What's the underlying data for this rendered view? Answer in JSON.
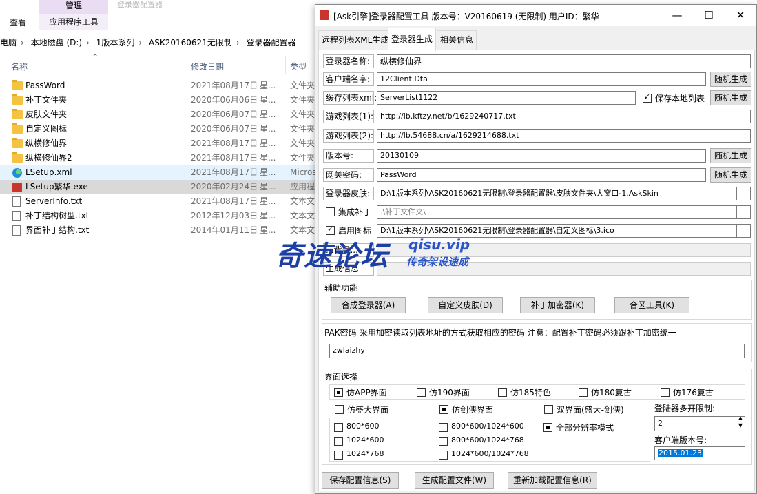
{
  "explorer": {
    "ribbon": {
      "view_tab": "查看",
      "manage_tab": "管理",
      "app_tools_tab": "应用程序工具",
      "faded_title": "登录器配置器"
    },
    "breadcrumb": [
      "电脑",
      "本地磁盘 (D:)",
      "1版本系列",
      "ASK20160621无限制",
      "登录器配置器"
    ],
    "columns": {
      "name": "名称",
      "date": "修改日期",
      "type": "类型"
    },
    "files": [
      {
        "name": "PassWord",
        "date": "2021年08月17日",
        "week": "星...",
        "type": "文件夹",
        "icon": "folder-icon"
      },
      {
        "name": "补丁文件夹",
        "date": "2020年06月06日",
        "week": "星...",
        "type": "文件夹",
        "icon": "folder-icon"
      },
      {
        "name": "皮肤文件夹",
        "date": "2020年06月07日",
        "week": "星...",
        "type": "文件夹",
        "icon": "folder-icon"
      },
      {
        "name": "自定义图标",
        "date": "2020年06月07日",
        "week": "星...",
        "type": "文件夹",
        "icon": "folder-icon"
      },
      {
        "name": "纵横修仙界",
        "date": "2021年08月17日",
        "week": "星...",
        "type": "文件夹",
        "icon": "folder-icon"
      },
      {
        "name": "纵横修仙界2",
        "date": "2021年08月17日",
        "week": "星...",
        "type": "文件夹",
        "icon": "folder-icon"
      },
      {
        "name": "LSetup.xml",
        "date": "2021年08月17日",
        "week": "星...",
        "type": "Micros",
        "icon": "edge-icon"
      },
      {
        "name": "LSetup繁华.exe",
        "date": "2020年02月24日",
        "week": "星...",
        "type": "应用程",
        "icon": "exe-icon"
      },
      {
        "name": "ServerInfo.txt",
        "date": "2021年08月17日",
        "week": "星...",
        "type": "文本文",
        "icon": "text-file-icon"
      },
      {
        "name": "补丁结构树型.txt",
        "date": "2012年12月03日",
        "week": "星...",
        "type": "文本文",
        "icon": "text-file-icon"
      },
      {
        "name": "界面补丁结构.txt",
        "date": "2014年01月11日",
        "week": "星...",
        "type": "文本文",
        "icon": "text-file-icon"
      }
    ]
  },
  "window": {
    "title": "[Ask引擎]登录器配置工具   版本号：V20160619 (无限制) 用户ID：繁华",
    "controls": {
      "minimize": "—",
      "maximize": "☐",
      "close": "✕"
    },
    "tabs": [
      "远程列表XML生成",
      "登录器生成",
      "相关信息"
    ],
    "form": {
      "login_name_label": "登录器名称:",
      "login_name_value": "纵横修仙界",
      "client_name_label": "客户端名字:",
      "client_name_value": "12Client.Dta",
      "cache_list_label": "缓存列表xml:",
      "cache_list_value": "ServerList1122",
      "save_local_label": "保存本地列表",
      "game_list1_label": "游戏列表(1):",
      "game_list1_value": "http://lb.kftzy.net/b/1629240717.txt",
      "game_list2_label": "游戏列表(2):",
      "game_list2_value": "http://lb.54688.cn/a/1629214688.txt",
      "version_label": "版本号:",
      "version_value": "20130109",
      "gateway_pwd_label": "网关密码:",
      "gateway_pwd_value": "PassWord",
      "skin_label": "登录器皮肤:",
      "skin_value": "D:\\1版本系列\\ASK20160621无限制\\登录器配置器\\皮肤文件夹\\大窗口-1.AskSkin",
      "integrate_patch_label": "集成补丁",
      "integrate_patch_value": ".\\补丁文件夹\\",
      "enable_icon_label": "启用图标",
      "enable_icon_value": "D:\\1版本系列\\ASK20160621无限制\\登录器配置器\\自定义图标\\3.ico",
      "hidden1_label": "...背景...",
      "hidden2_label": "生成信息",
      "random_button": "随机生成"
    },
    "aux": {
      "title": "辅助功能",
      "buttons": [
        "合成登录器(A)",
        "自定义皮肤(D)",
        "补丁加密器(K)",
        "合区工具(K)"
      ]
    },
    "pak": {
      "title": "PAK密码-采用加密读取列表地址的方式获取相应的密码 注意：配置补丁密码必须跟补丁加密统一",
      "value": "zwlaizhy"
    },
    "ui_select": {
      "title": "界面选择",
      "row1": [
        {
          "label": "仿APP界面",
          "on": true
        },
        {
          "label": "仿190界面",
          "on": false
        },
        {
          "label": "仿185特色",
          "on": false
        },
        {
          "label": "仿180复古",
          "on": false
        },
        {
          "label": "仿176复古",
          "on": false
        }
      ],
      "row2": [
        {
          "label": "仿盛大界面",
          "on": false
        },
        {
          "label": "仿剑侠界面",
          "on": true
        },
        {
          "label": "双界面(盛大-剑侠)",
          "on": false
        }
      ],
      "resolutions": [
        {
          "label": "800*600",
          "on": false
        },
        {
          "label": "800*600/1024*600",
          "on": false
        },
        {
          "label": "全部分辨率模式",
          "on": true
        },
        {
          "label": "1024*600",
          "on": false
        },
        {
          "label": "800*600/1024*768",
          "on": false
        },
        {
          "label": "1024*768",
          "on": false
        },
        {
          "label": "1024*600/1024*768",
          "on": false
        }
      ],
      "multi_open_label": "登陆器多开限制:",
      "multi_open_value": "2",
      "client_version_label": "客户端版本号:",
      "client_version_value": "2015.01.23"
    },
    "bottom_buttons": [
      "保存配置信息(S)",
      "生成配置文件(W)",
      "重新加载配置信息(R)"
    ]
  },
  "watermark": {
    "main": "奇速论坛",
    "url": "qisu.vip",
    "sub": "传奇架设速成"
  }
}
